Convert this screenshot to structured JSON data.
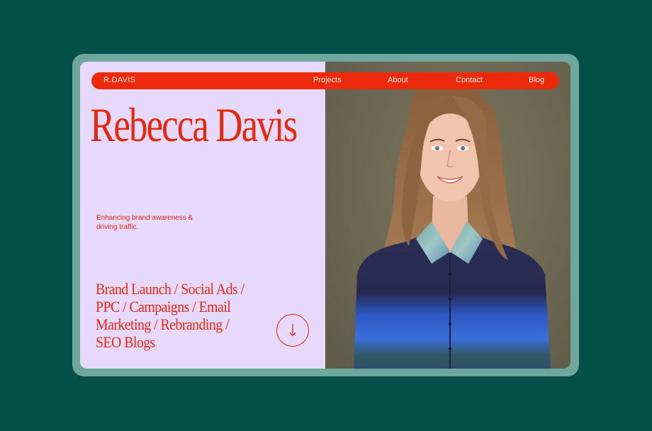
{
  "site": {
    "brand": "R.DAVIS",
    "nav": [
      {
        "label": "Projects"
      },
      {
        "label": "About"
      },
      {
        "label": "Contact"
      },
      {
        "label": "Blog"
      }
    ]
  },
  "hero": {
    "name": "Rebecca Davis",
    "tagline_line1": "Enhancing brand awareness &",
    "tagline_line2": "driving traffic.",
    "services": [
      "Brand Launch / Social Ads /",
      "PPC / Campaigns / Email",
      "Marketing / Rebranding /",
      "SEO Blogs"
    ],
    "scroll_icon": "arrow-down-icon"
  },
  "colors": {
    "outer_background": "#045149",
    "frame": "#6ea79d",
    "left_panel": "#e6d9fb",
    "accent": "#e6290e",
    "navbar": "#ee2a0c",
    "photo_background": "#6f6a54"
  },
  "photo": {
    "subject": "portrait-photo"
  }
}
